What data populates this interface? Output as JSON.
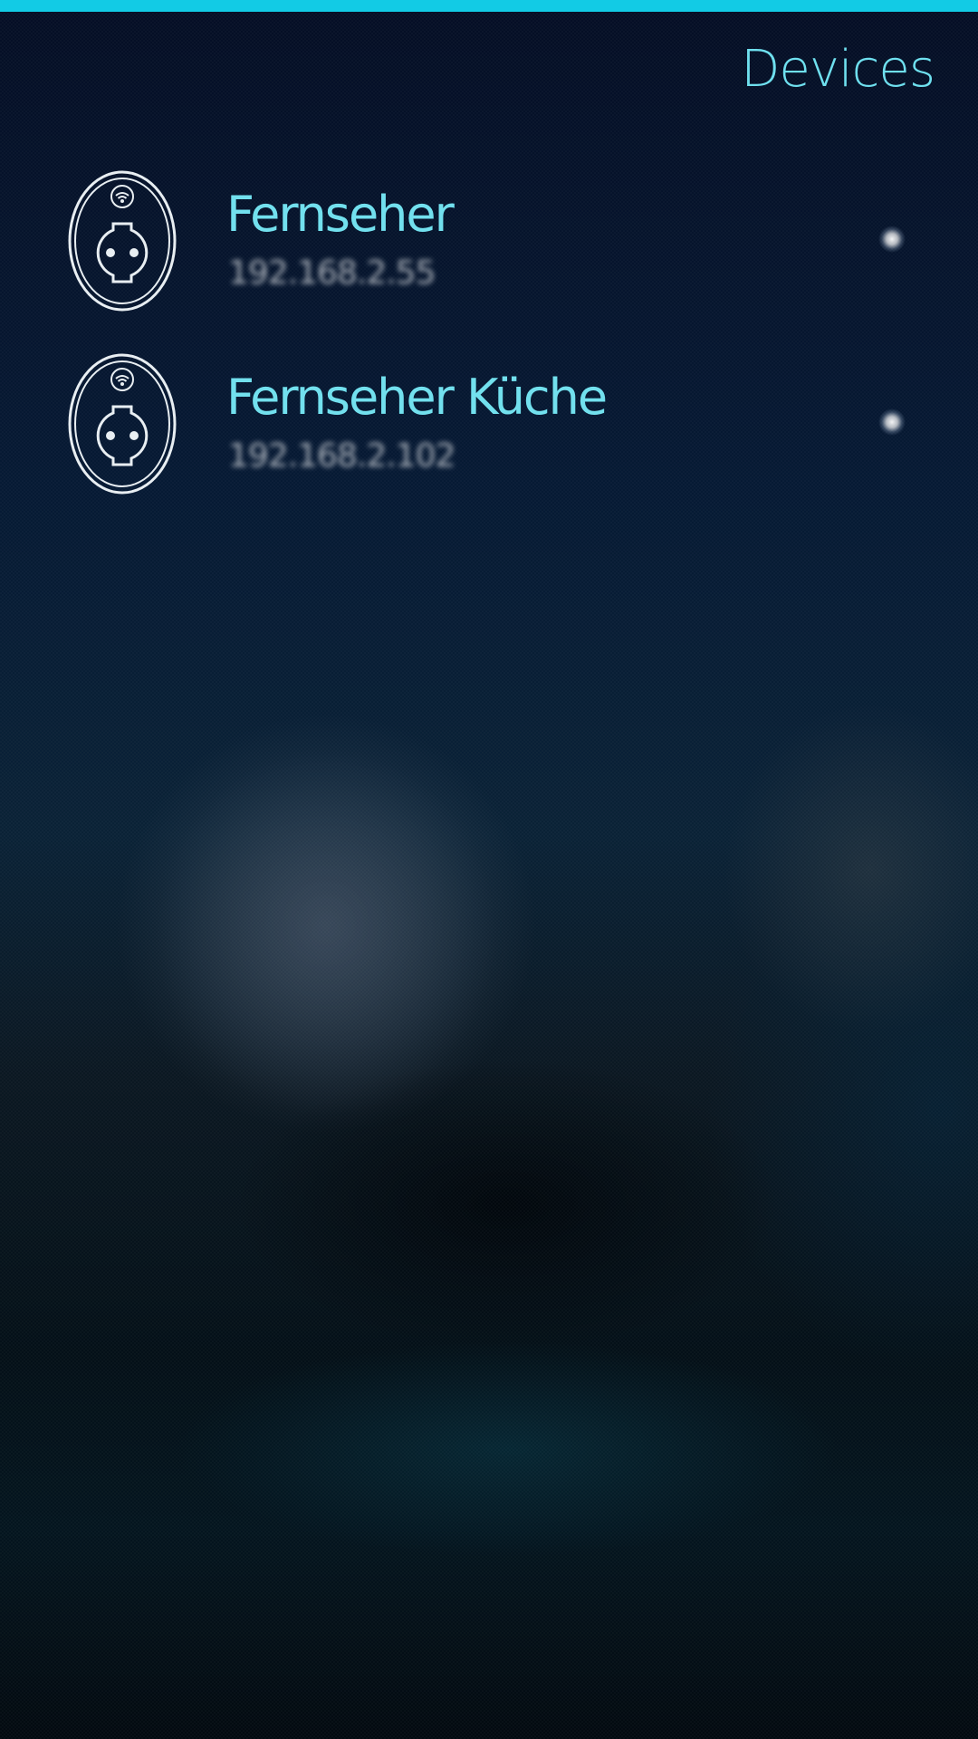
{
  "header": {
    "title": "Devices"
  },
  "colors": {
    "accent": "#12cbe5",
    "title_text": "#6fe0ef",
    "secondary_text": "#d3d7dc"
  },
  "devices": [
    {
      "name": "Fernseher",
      "address": "192.168.2.55",
      "icon": "smart-plug-icon",
      "status_icon": "status-indicator-icon"
    },
    {
      "name": "Fernseher Küche",
      "address": "192.168.2.102",
      "icon": "smart-plug-icon",
      "status_icon": "status-indicator-icon"
    }
  ]
}
